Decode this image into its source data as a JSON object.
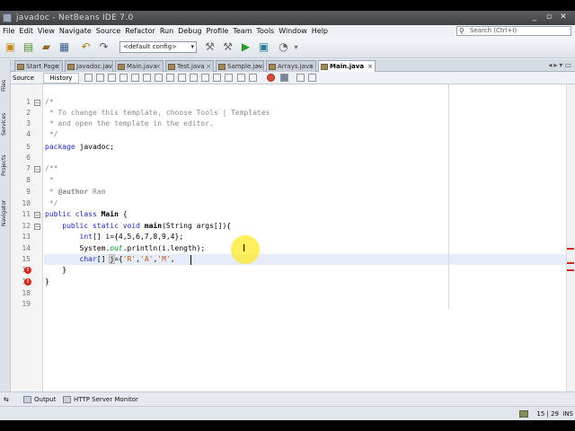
{
  "window": {
    "title": "javadoc - NetBeans IDE 7.0",
    "controls": [
      "_",
      "▫",
      "✕"
    ]
  },
  "menubar": {
    "items": [
      "File",
      "Edit",
      "View",
      "Navigate",
      "Source",
      "Refactor",
      "Run",
      "Debug",
      "Profile",
      "Team",
      "Tools",
      "Window",
      "Help"
    ]
  },
  "search": {
    "placeholder": "Search (Ctrl+I)"
  },
  "toolbar": {
    "config_value": "<default config>"
  },
  "sidebar": {
    "tabs": [
      "Files",
      "Services",
      "Projects",
      "Navigator"
    ]
  },
  "editor_tabs": {
    "tabs": [
      "Start Page",
      "Javadoc.java",
      "Main.java",
      "Test.java",
      "Sample.java",
      "Arrays.java",
      "Main.java"
    ],
    "active_index": 6
  },
  "editor_toolbar": {
    "source_label": "Source",
    "history_label": "History"
  },
  "editor": {
    "line_numbers": [
      "1",
      "2",
      "3",
      "4",
      "5",
      "6",
      "7",
      "8",
      "9",
      "10",
      "11",
      "12",
      "13",
      "14",
      "15",
      "16",
      "17",
      "18",
      "19"
    ],
    "lines": {
      "l1": "/*",
      "l2": " * To change this template, choose Tools | Templates",
      "l3": " * and open the template in the editor.",
      "l4": " */",
      "l5a": "package",
      "l5b": " javadoc;",
      "l7": "/**",
      "l8": " *",
      "l9a": " * ",
      "l9b": "@author",
      "l9c": " Ram",
      "l10": " */",
      "l11a": "public class",
      "l11b": " Main ",
      "l11c": "{",
      "l12a": "    public static void",
      "l12b": " main",
      "l12c": "(String args[]){",
      "l13a": "        int",
      "l13b": "[] i={4,5,6,7,8,9,4};",
      "l14a": "        System.",
      "l14b": "out",
      "l14c": ".println(i.length);",
      "l15a": "        char",
      "l15b": "[] ",
      "l15c": "j",
      "l15d": "={",
      "l15e": "'R'",
      "l15f": ",",
      "l15g": "'A'",
      "l15h": ",",
      "l15i": "'M'",
      "l15j": ",",
      "l16": "    }",
      "l17": "}"
    }
  },
  "output_bar": {
    "output_label": "Output",
    "http_label": "HTTP Server Monitor"
  },
  "status": {
    "position": "15 | 29",
    "mode": "INS"
  },
  "colors": {
    "keyword": "#1f2bb3",
    "comment": "#8a8a8a",
    "string": "#c2581b",
    "error": "#d02b20"
  }
}
